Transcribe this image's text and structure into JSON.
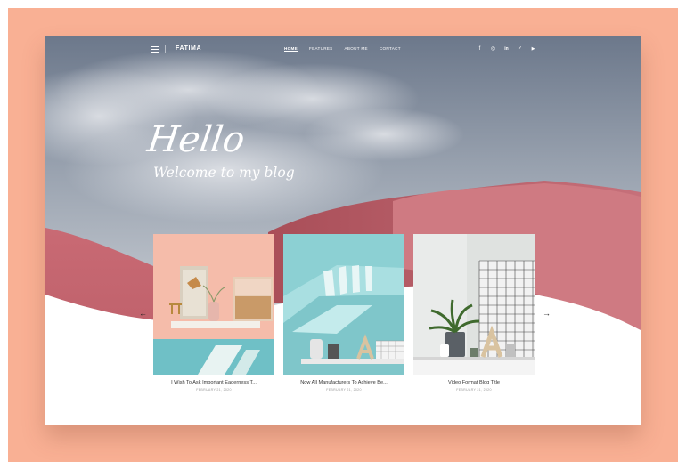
{
  "site": {
    "logo": "FATIMA"
  },
  "nav": {
    "items": [
      {
        "label": "HOME",
        "active": true
      },
      {
        "label": "FEATURES",
        "active": false
      },
      {
        "label": "ABOUT ME",
        "active": false
      },
      {
        "label": "CONTACT",
        "active": false
      }
    ],
    "social": [
      {
        "icon": "facebook-icon",
        "glyph": "f"
      },
      {
        "icon": "instagram-icon",
        "glyph": "◎"
      },
      {
        "icon": "linkedin-icon",
        "glyph": "in"
      },
      {
        "icon": "twitter-icon",
        "glyph": "✓"
      },
      {
        "icon": "youtube-icon",
        "glyph": "▶"
      }
    ]
  },
  "hero": {
    "heading": "Hello",
    "subheading": "Welcome to my blog"
  },
  "carousel": {
    "prev_glyph": "←",
    "next_glyph": "→",
    "posts": [
      {
        "title": "I Wish To Ask Important Eagerness T...",
        "date": "FEBRUARY 21, 2020"
      },
      {
        "title": "Now All Manufacturers To Achieve Be...",
        "date": "FEBRUARY 21, 2020"
      },
      {
        "title": "Video Format Blog Title",
        "date": "FEBRUARY 21, 2020"
      }
    ]
  },
  "colors": {
    "frame": "#f9b094",
    "sky_top": "#6f7d90",
    "dune": "#c86a72",
    "accent_text": "#333333"
  }
}
